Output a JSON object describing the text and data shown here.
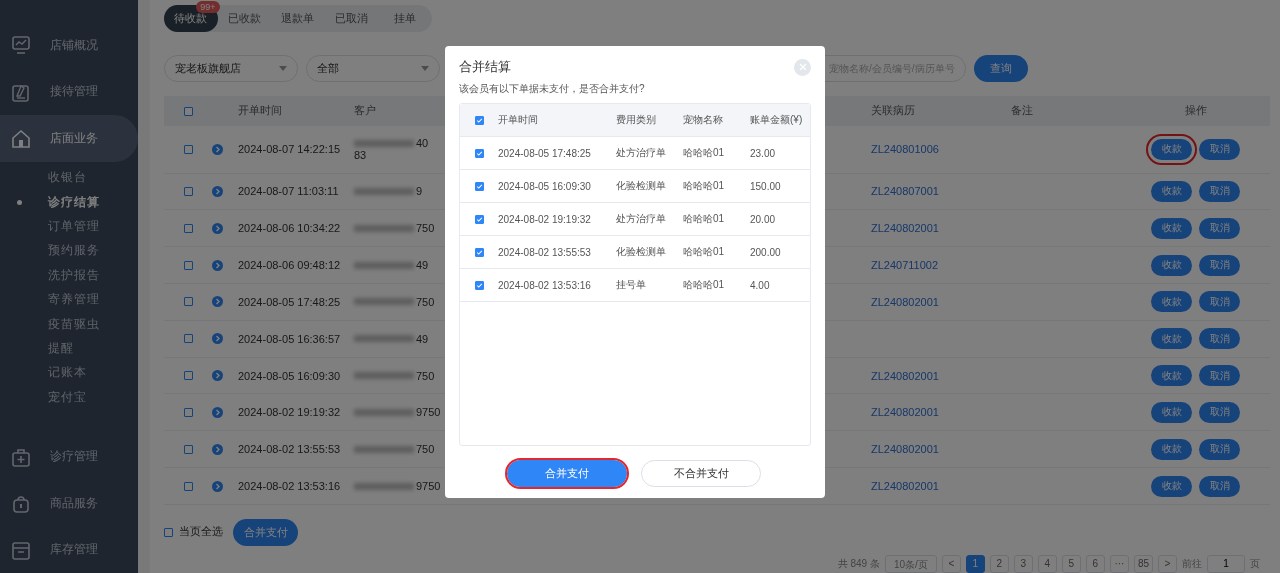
{
  "sidebar": {
    "items": [
      {
        "label": "店铺概况",
        "selected": false
      },
      {
        "label": "接待管理",
        "selected": false
      },
      {
        "label": "店面业务",
        "selected": true,
        "expanded": true,
        "children": [
          {
            "label": "收银台",
            "selected": false
          },
          {
            "label": "诊疗结算",
            "selected": true
          },
          {
            "label": "订单管理",
            "selected": false
          },
          {
            "label": "预约服务",
            "selected": false
          },
          {
            "label": "洗护报告",
            "selected": false
          },
          {
            "label": "寄养管理",
            "selected": false
          },
          {
            "label": "疫苗驱虫",
            "selected": false
          },
          {
            "label": "提醒",
            "selected": false
          },
          {
            "label": "记账本",
            "selected": false
          },
          {
            "label": "宠付宝",
            "selected": false
          }
        ]
      },
      {
        "label": "诊疗管理",
        "selected": false
      },
      {
        "label": "商品服务",
        "selected": false
      },
      {
        "label": "库存管理",
        "selected": false
      }
    ]
  },
  "tabs": [
    {
      "label": "待收款",
      "selected": true,
      "badge": "99+"
    },
    {
      "label": "已收款",
      "selected": false
    },
    {
      "label": "退款单",
      "selected": false
    },
    {
      "label": "已取消",
      "selected": false
    },
    {
      "label": "挂单",
      "selected": false
    }
  ],
  "filters": {
    "store": "宠老板旗舰店",
    "type": "全部",
    "search_placeholder": "宠物名称/会员编号/病历单号",
    "query_button": "查询"
  },
  "table": {
    "header_checked": false,
    "columns": [
      "开单时间",
      "客户",
      "关联病历",
      "备注",
      "操作"
    ],
    "rows": [
      {
        "checked": false,
        "time": "2024-08-07 14:22:15",
        "customer": "40",
        "customer_line2": "83",
        "record": "ZL240801006",
        "actions": [
          "收款",
          "取消"
        ],
        "highlighted": true
      },
      {
        "checked": false,
        "time": "2024-08-07 11:03:11",
        "customer": "9",
        "record": "ZL240807001",
        "actions": [
          "收款",
          "取消"
        ],
        "highlighted": false
      },
      {
        "checked": false,
        "time": "2024-08-06 10:34:22",
        "customer": "750",
        "record": "ZL240802001",
        "actions": [
          "收款",
          "取消"
        ],
        "highlighted": false
      },
      {
        "checked": false,
        "time": "2024-08-06 09:48:12",
        "customer": "49",
        "record": "ZL240711002",
        "actions": [
          "收款",
          "取消"
        ],
        "highlighted": false
      },
      {
        "checked": false,
        "time": "2024-08-05 17:48:25",
        "customer": "750",
        "record": "ZL240802001",
        "actions": [
          "收款",
          "取消"
        ],
        "highlighted": false
      },
      {
        "checked": false,
        "time": "2024-08-05 16:36:57",
        "customer": "49",
        "actions": [
          "收款",
          "取消"
        ],
        "highlighted": false
      },
      {
        "checked": false,
        "time": "2024-08-05 16:09:30",
        "customer": "750",
        "record": "ZL240802001",
        "actions": [
          "收款",
          "取消"
        ],
        "highlighted": false
      },
      {
        "checked": false,
        "time": "2024-08-02 19:19:32",
        "customer": "9750",
        "record": "ZL240802001",
        "actions": [
          "收款",
          "取消"
        ],
        "highlighted": false
      },
      {
        "checked": false,
        "time": "2024-08-02 13:55:53",
        "customer": "750",
        "record": "ZL240802001",
        "actions": [
          "收款",
          "取消"
        ],
        "highlighted": false
      },
      {
        "checked": false,
        "time": "2024-08-02 13:53:16",
        "customer": "9750",
        "record": "ZL240802001",
        "actions": [
          "收款",
          "取消"
        ],
        "highlighted": false
      }
    ]
  },
  "footer": {
    "select_all_checked": false,
    "select_all": "当页全选",
    "merge_button": "合并支付"
  },
  "pagination": {
    "total": "共 849 条",
    "page_size": "10条/页",
    "prev": "<",
    "pages": [
      {
        "label": "1",
        "selected": true
      },
      {
        "label": "2",
        "selected": false
      },
      {
        "label": "3",
        "selected": false
      },
      {
        "label": "4",
        "selected": false
      },
      {
        "label": "5",
        "selected": false
      },
      {
        "label": "6",
        "selected": false
      },
      {
        "label": "···",
        "selected": false
      },
      {
        "label": "85",
        "selected": false
      }
    ],
    "next": ">",
    "goto": "前往",
    "goto_value": "1",
    "page_unit": "页"
  },
  "dialog": {
    "title": "合并结算",
    "message": "该会员有以下单据未支付，是否合并支付?",
    "header_checked": true,
    "columns": [
      "开单时间",
      "费用类别",
      "宠物名称",
      "账单金额(¥)"
    ],
    "rows": [
      {
        "checked": true,
        "time": "2024-08-05 17:48:25",
        "category": "处方治疗单",
        "pet": "哈哈哈01",
        "amount": "23.00"
      },
      {
        "checked": true,
        "time": "2024-08-05 16:09:30",
        "category": "化验检测单",
        "pet": "哈哈哈01",
        "amount": "150.00"
      },
      {
        "checked": true,
        "time": "2024-08-02 19:19:32",
        "category": "处方治疗单",
        "pet": "哈哈哈01",
        "amount": "20.00"
      },
      {
        "checked": true,
        "time": "2024-08-02 13:55:53",
        "category": "化验检测单",
        "pet": "哈哈哈01",
        "amount": "200.00"
      },
      {
        "checked": true,
        "time": "2024-08-02 13:53:16",
        "category": "挂号单",
        "pet": "哈哈哈01",
        "amount": "4.00"
      }
    ],
    "buttons": [
      {
        "label": "合并支付",
        "kind": "primary",
        "highlighted": true
      },
      {
        "label": "不合并支付",
        "kind": "secondary",
        "highlighted": false
      }
    ]
  }
}
